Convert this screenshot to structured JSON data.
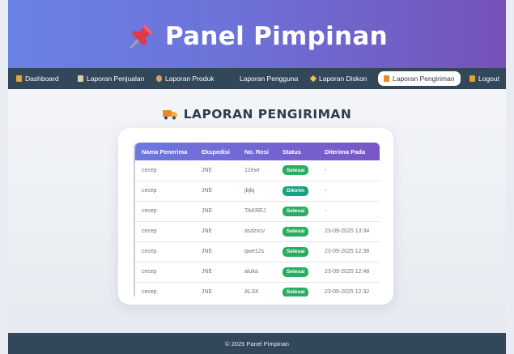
{
  "header": {
    "title": "Panel Pimpinan",
    "icon": "pushpin-icon"
  },
  "nav": {
    "items": [
      {
        "label": "Dashboard",
        "icon": "dashboard-icon",
        "color": "#e8a33a"
      },
      {
        "label": "Laporan Penjualan",
        "icon": "report-icon",
        "color": "#d9d2a8"
      },
      {
        "label": "Laporan Produk",
        "icon": "product-icon",
        "color": "#e0a060"
      },
      {
        "label": "Laporan Pengguna",
        "icon": "users-icon",
        "color": "#33475b"
      },
      {
        "label": "Laporan Diskon",
        "icon": "tag-icon",
        "color": "#f0c34a"
      },
      {
        "label": "Laporan Pengiriman",
        "icon": "truck-icon",
        "color": "#e8892a",
        "active": true
      },
      {
        "label": "Logout",
        "icon": "logout-icon",
        "color": "#d9a23a"
      }
    ]
  },
  "section": {
    "title": "LAPORAN PENGIRIMAN"
  },
  "table": {
    "columns": [
      "Nama Penerima",
      "Ekspedisi",
      "No. Resi",
      "Status",
      "Diterima Pada"
    ],
    "rows": [
      {
        "name": "cecep",
        "courier": "JNE",
        "resi": "12ewr",
        "status": "Selesai",
        "received": "-"
      },
      {
        "name": "cecep",
        "courier": "JNE",
        "resi": "jbjbj",
        "status": "Dikirim",
        "received": "-"
      },
      {
        "name": "cecep",
        "courier": "JNE",
        "resi": "TAKREJ",
        "status": "Selesai",
        "received": "-"
      },
      {
        "name": "cecep",
        "courier": "JNE",
        "resi": "asdzxcv",
        "status": "Selesai",
        "received": "23-09-2025 13:34"
      },
      {
        "name": "cecep",
        "courier": "JNE",
        "resi": "qwe12s",
        "status": "Selesai",
        "received": "23-09-2025 12:38"
      },
      {
        "name": "cecep",
        "courier": "JNE",
        "resi": "aluka",
        "status": "Selesai",
        "received": "23-09-2025 12:48"
      },
      {
        "name": "cecep",
        "courier": "JNE",
        "resi": "ALSK",
        "status": "Selesai",
        "received": "23-09-2025 12:32"
      }
    ],
    "status_colors": {
      "Selesai": "#27ae60",
      "Dikirim": "#16a085"
    }
  },
  "footer": {
    "text": "© 2025 Panel Pimpinan"
  }
}
